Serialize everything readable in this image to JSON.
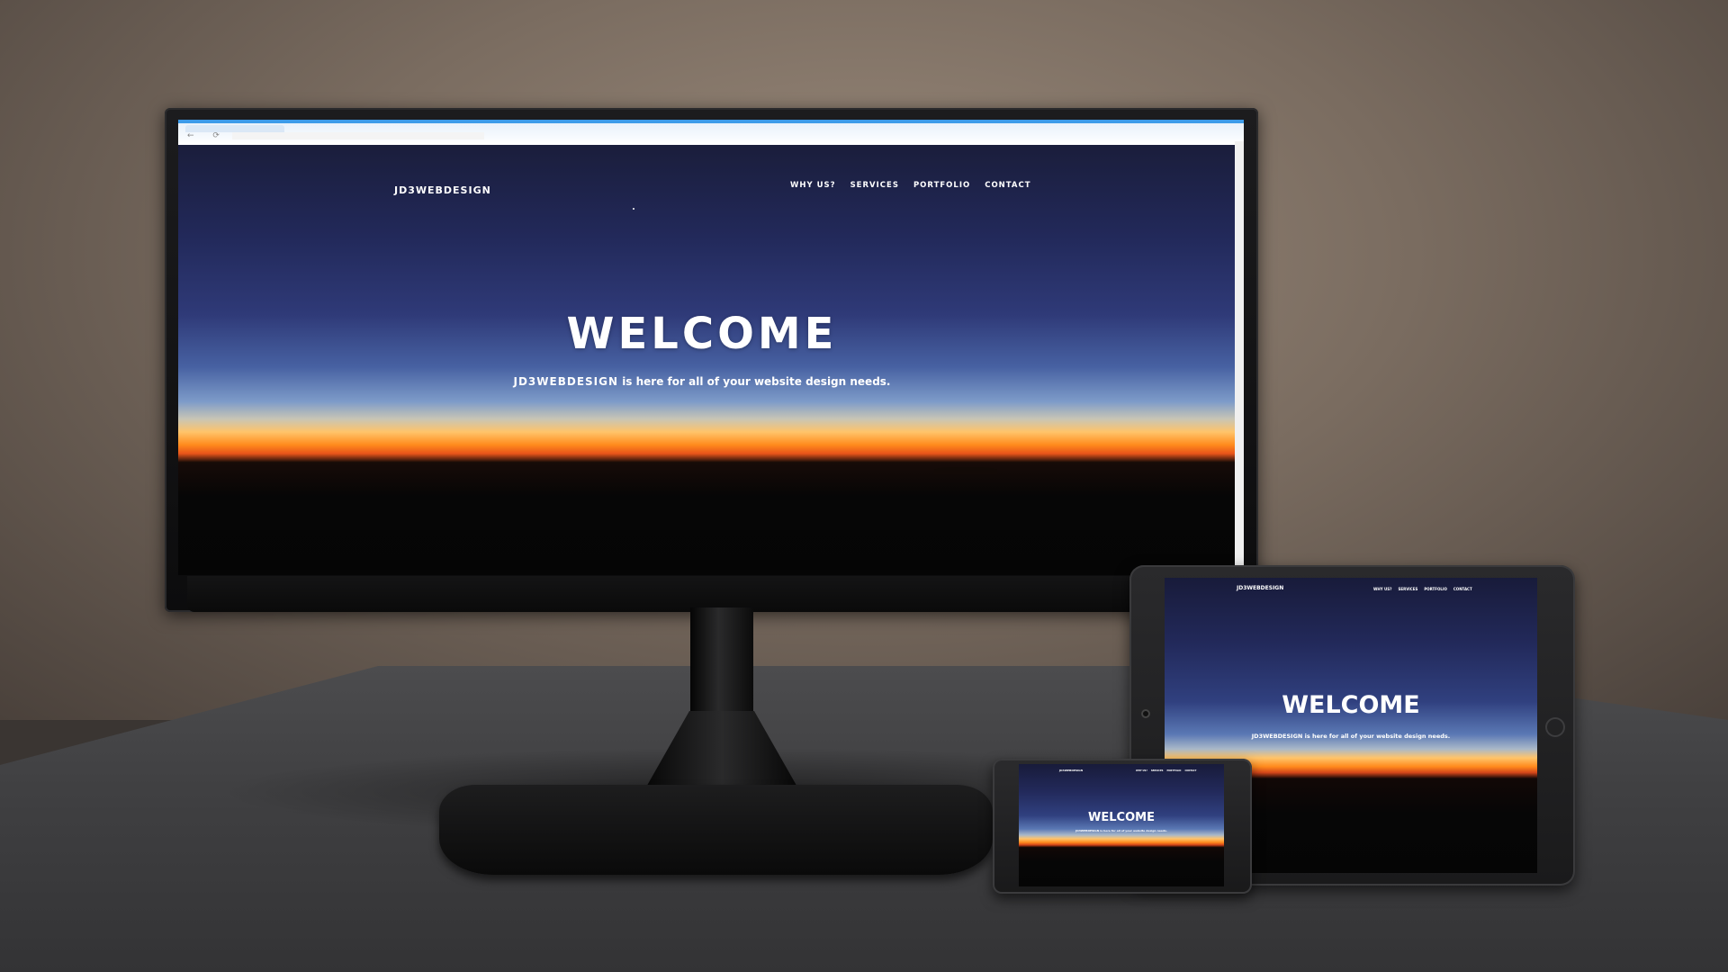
{
  "site": {
    "logo": "JD3WEBDESIGN",
    "nav": [
      "WHY US?",
      "SERVICES",
      "PORTFOLIO",
      "CONTACT"
    ],
    "headline": "WELCOME",
    "tagline_brand": "JD3WEBDESIGN",
    "tagline_rest": " is here for all of your website design needs."
  },
  "colors": {
    "browser_accent": "#3d9be9",
    "sky_top": "#1a1d3a",
    "horizon_orange": "#ff8a1c"
  },
  "icons": {
    "back": "←",
    "refresh": "⟳"
  }
}
